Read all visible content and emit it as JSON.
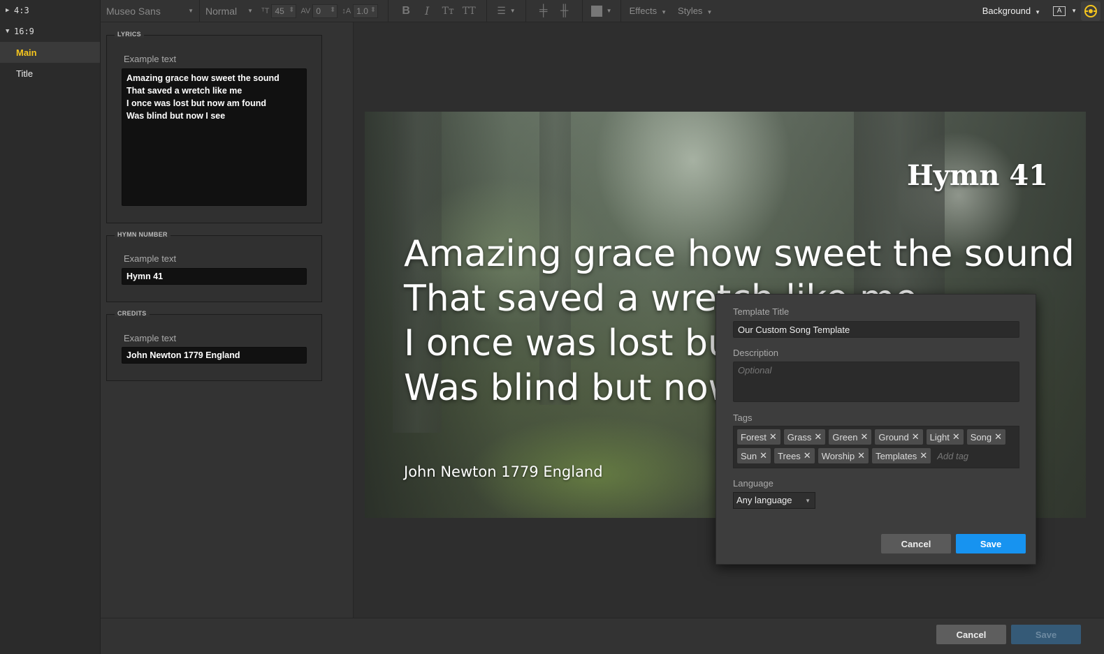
{
  "sidebar": {
    "ratios": [
      {
        "label": "4:3",
        "expanded": false
      },
      {
        "label": "16:9",
        "expanded": true
      }
    ],
    "slides": [
      {
        "label": "Main",
        "active": true
      },
      {
        "label": "Title",
        "active": false
      }
    ]
  },
  "toolbar": {
    "font_family": "Museo Sans",
    "font_weight": "Normal",
    "font_size": "45",
    "letter_spacing": "0",
    "line_height": "1.0",
    "effects_label": "Effects",
    "styles_label": "Styles",
    "background_label": "Background",
    "text_icon_label": "A"
  },
  "fields": {
    "lyrics": {
      "legend": "LYRICS",
      "example": "Example text",
      "value": "Amazing grace how sweet the sound\nThat saved a wretch like me\nI once was lost but now am found\nWas blind but now I see"
    },
    "hymn_number": {
      "legend": "HYMN NUMBER",
      "example": "Example text",
      "value": "Hymn 41"
    },
    "credits": {
      "legend": "CREDITS",
      "example": "Example text",
      "value": "John Newton 1779 England"
    }
  },
  "slide": {
    "hymn": "Hymn 41",
    "lyrics": "Amazing grace how sweet the sound\nThat saved a wretch like me\nI once was lost but now am found\nWas blind but now I see",
    "credits": "John Newton 1779 England"
  },
  "dialog": {
    "title_label": "Template Title",
    "title_value": "Our Custom Song Template",
    "description_label": "Description",
    "description_placeholder": "Optional",
    "tags_label": "Tags",
    "tags": [
      "Forest",
      "Grass",
      "Green",
      "Ground",
      "Light",
      "Song",
      "Sun",
      "Trees",
      "Worship",
      "Templates"
    ],
    "add_tag_placeholder": "Add tag",
    "language_label": "Language",
    "language_value": "Any language",
    "cancel_label": "Cancel",
    "save_label": "Save"
  },
  "bottombar": {
    "cancel_label": "Cancel",
    "save_label": "Save"
  },
  "colors": {
    "active_slide": "#f5c51e",
    "primary_button": "#1793f0",
    "disabled_button": "#355a77"
  }
}
